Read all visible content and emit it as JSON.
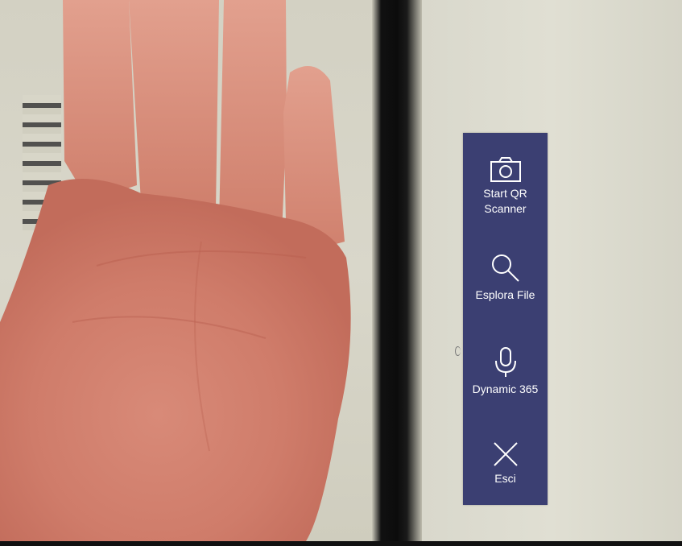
{
  "menu": {
    "items": [
      {
        "id": "start-qr",
        "label_line1": "Start QR",
        "label_line2": "Scanner",
        "icon": "camera-icon"
      },
      {
        "id": "esplora",
        "label_line1": "Esplora File",
        "icon": "search-icon"
      },
      {
        "id": "dynamic",
        "label_line1": "Dynamic 365",
        "icon": "microphone-icon"
      },
      {
        "id": "esci",
        "label_line1": "Esci",
        "icon": "close-icon"
      }
    ],
    "background": "#3b3f72",
    "text_color": "#ffffff"
  }
}
